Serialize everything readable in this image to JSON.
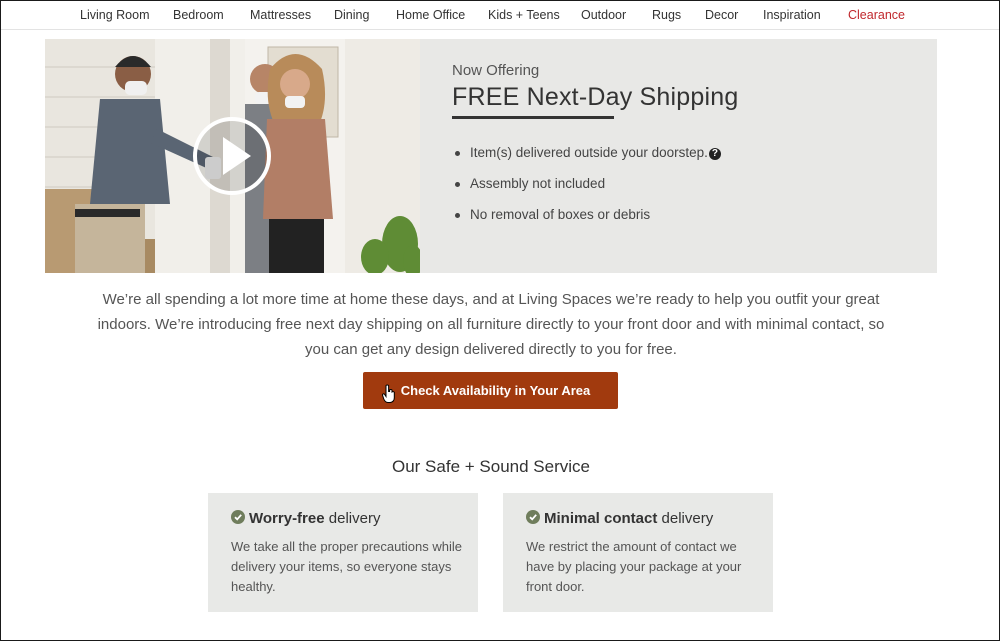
{
  "nav": {
    "items": [
      {
        "label": "Living Room"
      },
      {
        "label": "Bedroom"
      },
      {
        "label": "Mattresses"
      },
      {
        "label": "Dining"
      },
      {
        "label": "Home Office"
      },
      {
        "label": "Kids + Teens"
      },
      {
        "label": "Outdoor"
      },
      {
        "label": "Rugs"
      },
      {
        "label": "Decor"
      },
      {
        "label": "Inspiration"
      },
      {
        "label": "Clearance"
      }
    ],
    "highlight_color": "#c0282d"
  },
  "hero": {
    "eyebrow": "Now Offering",
    "title": "FREE Next-Day Shipping",
    "bullets": [
      "Item(s) delivered outside your doorstep.",
      "Assembly not included",
      "No removal of boxes or debris"
    ],
    "video_icon": "play-icon"
  },
  "intro": {
    "text": "We’re all spending a lot more time at home these days, and at Living Spaces we’re ready to help you outfit your great indoors. We’re introducing free next day shipping on all furniture directly to your front door and with minimal contact, so you can get any design delivered directly to you for free."
  },
  "cta": {
    "label": "Check Availability in Your Area",
    "color": "#a13a0e"
  },
  "service": {
    "heading": "Our Safe + Sound Service",
    "cards": [
      {
        "title_bold": "Worry-free",
        "title_rest": " delivery",
        "body": "We take all the proper precautions while delivery your items, so everyone stays healthy."
      },
      {
        "title_bold": "Minimal contact",
        "title_rest": " delivery",
        "body": "We restrict the amount of contact we have by placing your package at your front door."
      }
    ],
    "check_color": "#6f7d5c"
  }
}
